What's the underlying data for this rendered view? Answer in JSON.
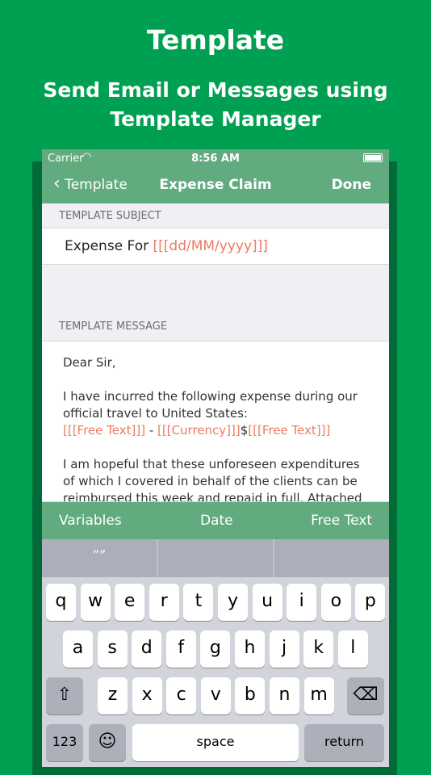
{
  "header": {
    "title": "Template",
    "subtitle": "Send Email or Messages using Template Manager"
  },
  "status": {
    "carrier": "Carrier",
    "time": "8:56 AM"
  },
  "nav": {
    "back": "Template",
    "title": "Expense Claim",
    "done": "Done"
  },
  "subject": {
    "section": "TEMPLATE SUBJECT",
    "text": "Expense For ",
    "var": "[[[dd/MM/yyyy]]]"
  },
  "message": {
    "section": "TEMPLATE MESSAGE",
    "greeting": "Dear Sir,",
    "p1": "I have incurred the following expense during our official travel to United States:",
    "v1": "[[[Free Text]]]",
    "dash": " - ",
    "v2": "[[[Currency]]]",
    "dollar": "$",
    "v3": "[[[Free Text]]]",
    "p2": "I am hopeful that these unforeseen expenditures of which I covered in behalf of the clients can be reimbursed this week and repaid in full. Attached"
  },
  "toolbar": {
    "variables": "Variables",
    "date": "Date",
    "free_text": "Free Text"
  },
  "suggestions": [
    "””",
    "",
    ""
  ],
  "keyboard": {
    "row1": [
      "q",
      "w",
      "e",
      "r",
      "t",
      "y",
      "u",
      "i",
      "o",
      "p"
    ],
    "row2": [
      "a",
      "s",
      "d",
      "f",
      "g",
      "h",
      "j",
      "k",
      "l"
    ],
    "row3": [
      "z",
      "x",
      "c",
      "v",
      "b",
      "n",
      "m"
    ],
    "num": "123",
    "space": "space",
    "return": "return"
  }
}
